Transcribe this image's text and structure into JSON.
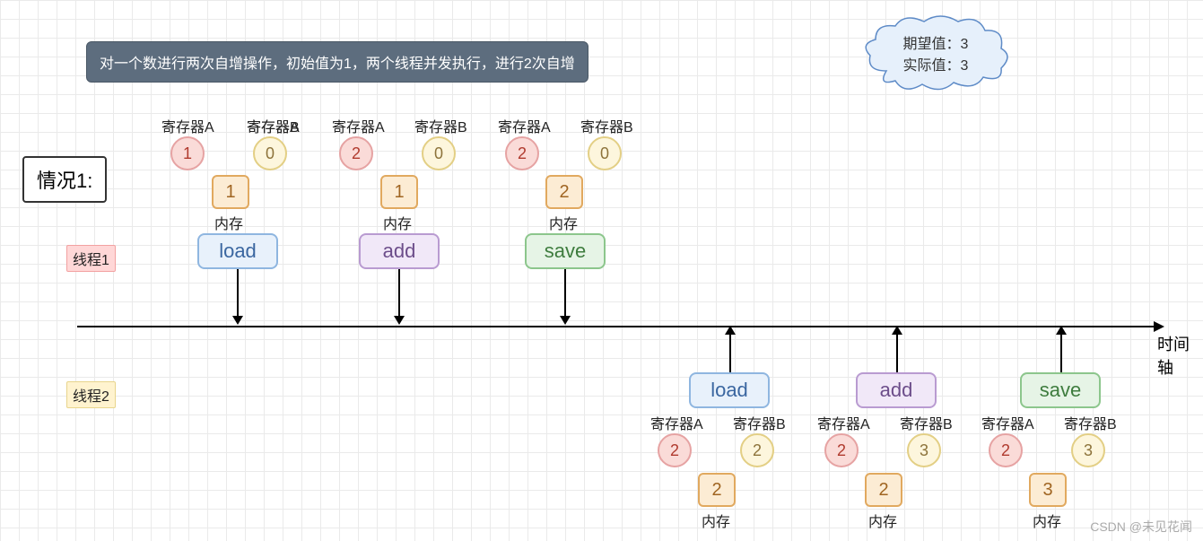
{
  "description": "对一个数进行两次自增操作，初始值为1，两个线程并发执行，进行2次自增",
  "expected_label": "期望值：3",
  "actual_label": "实际值：3",
  "case_label": "情况1:",
  "thread1_label": "线程1",
  "thread2_label": "线程2",
  "axis_label": "时间轴",
  "watermark": "CSDN @未见花闻",
  "reg_a_label": "寄存器A",
  "reg_b_label": "寄存器B",
  "mem_label": "内存",
  "thread1": {
    "steps": [
      {
        "op": "load",
        "reg_a": "1",
        "reg_b": "0",
        "mem": "1"
      },
      {
        "op": "add",
        "reg_a": "2",
        "reg_b": "0",
        "mem": "1"
      },
      {
        "op": "save",
        "reg_a": "2",
        "reg_b": "0",
        "mem": "2"
      }
    ]
  },
  "thread2": {
    "steps": [
      {
        "op": "load",
        "reg_a": "2",
        "reg_b": "2",
        "mem": "2"
      },
      {
        "op": "add",
        "reg_a": "2",
        "reg_b": "3",
        "mem": "2"
      },
      {
        "op": "save",
        "reg_a": "2",
        "reg_b": "3",
        "mem": "3"
      }
    ]
  }
}
